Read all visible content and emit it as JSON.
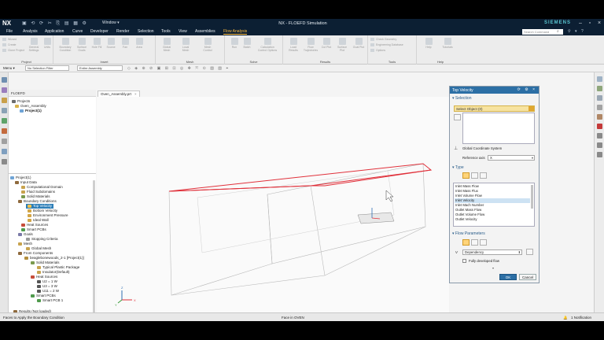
{
  "titlebar": {
    "logo": "NX",
    "window_menu": "Window ▾",
    "title": "NX - FLOEFD Simulation",
    "brand": "SIEMENS"
  },
  "menubar": {
    "items": [
      "File",
      "Analysis",
      "Application",
      "Curve",
      "Developer",
      "Render",
      "Selection",
      "Tools",
      "View",
      "Assemblies",
      "Flow Analysis"
    ],
    "active": "Flow Analysis",
    "search_placeholder": "Search Command"
  },
  "ribbon": {
    "groups": [
      "Project",
      "Insert",
      "Mesh",
      "Solve",
      "Results",
      "Tools",
      "Help"
    ],
    "project_items": [
      "Wizard",
      "Create",
      "Clone Project",
      "General Settings",
      "Units"
    ],
    "insert_items": [
      "Boundary Condition",
      "Surface Goals",
      "Hole Fill",
      "Source",
      "Fan",
      "Area"
    ],
    "mesh_items": [
      "Global Mesh",
      "Local Mesh",
      "Mesh Control"
    ],
    "solve_items": [
      "Run",
      "Batch",
      "Calculation Control Options"
    ],
    "results_items": [
      "Load Results",
      "Flow Trajectories",
      "Cut Plot",
      "Surface Plot",
      "Goal Plot"
    ],
    "tools_items": [
      "Check Geometry",
      "Engineering Database",
      "Options"
    ],
    "help_items": [
      "Help",
      "Tutorials"
    ]
  },
  "selbar": {
    "menu": "Menu ▾",
    "filter": "No Selection Filter",
    "scope": "Entire Assembly"
  },
  "navigator": {
    "header": "FLOEFD",
    "top_tree": [
      "Projects",
      "Oven_Assembly",
      "Project(1)"
    ],
    "tree": [
      "Project(1)",
      "Input Data",
      "Computational Domain",
      "Fluid Subdomains",
      "Solid Materials",
      "Boundary Conditions",
      "Top Velocity",
      "Bottom Velocity",
      "Environment Pressure",
      "Ideal Wall",
      "Heat Sources",
      "Smart PCBs",
      "Goals",
      "Stopping Criteria",
      "Mesh",
      "Global Mesh",
      "From Components",
      "beaglebonewoods_2-1 [Project(1)]",
      "Solid Materials",
      "Typical Plastic Package",
      "Insulator(Default)",
      "Heat Sources",
      "U2 = 1 W",
      "U3 = 3 W",
      "U11 = 2 W",
      "Smart PCBs",
      "Smart PCB 1",
      "Results (Not loaded)"
    ],
    "selected": "Top Velocity"
  },
  "graphics": {
    "tab_label": "Oven_Assembly.prt",
    "triad": {
      "x": "X",
      "y": "Y",
      "z": "Z"
    }
  },
  "dialog": {
    "title": "Top Velocity",
    "selection_header": "Selection",
    "select_object": "Select Object (0)",
    "coord_system": "Global Coordinate System",
    "ref_axis_label": "Reference axis",
    "ref_axis_value": "X",
    "type_header": "Type",
    "type_list": [
      "Inlet Mass Flow",
      "Inlet Mass Flux",
      "Inlet Volume Flow",
      "Inlet Velocity",
      "Inlet Mach Number",
      "Outlet Mass Flow",
      "Outlet Volume Flow",
      "Outlet Velocity"
    ],
    "type_selected": "Inlet Velocity",
    "flow_header": "Flow Parameters",
    "v_label": "V",
    "dependency": "Dependency",
    "fully_developed": "Fully developed flow",
    "ok": "OK",
    "cancel": "Cancel"
  },
  "status": {
    "left": "Faces to Apply the Boundary Condition",
    "middle": "Face in OVEN",
    "right": "1 Notification"
  },
  "colors": {
    "titlebar": "#0c1f33",
    "accent": "#ffbd40",
    "dialog_title": "#2c6fa5",
    "highlight": "#2e7fb8",
    "box_edge": "#e0303a"
  }
}
